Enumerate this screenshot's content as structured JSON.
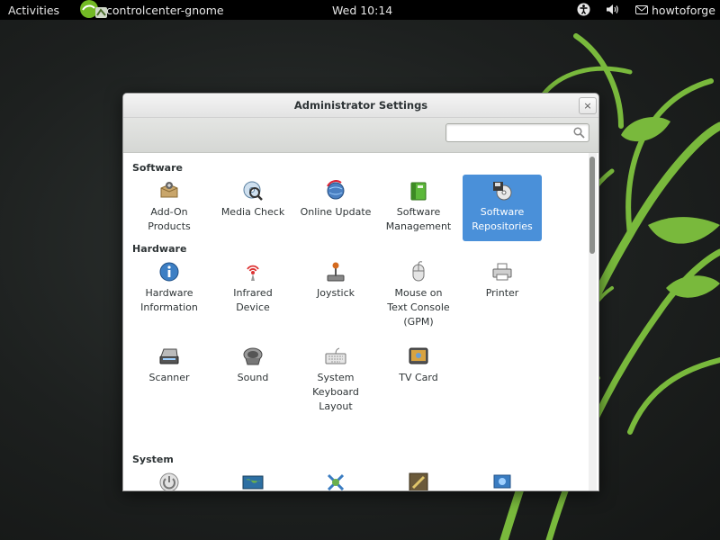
{
  "topbar": {
    "activities": "Activities",
    "app_name": "controlcenter-gnome",
    "clock": "Wed 10:14",
    "user": "howtoforge"
  },
  "window": {
    "title": "Administrator Settings",
    "close_glyph": "×"
  },
  "search": {
    "placeholder": ""
  },
  "sections": {
    "software": {
      "title": "Software",
      "items": [
        {
          "label": "Add-On\nProducts",
          "icon": "package-icon"
        },
        {
          "label": "Media Check",
          "icon": "disc-check-icon"
        },
        {
          "label": "Online Update",
          "icon": "update-globe-icon"
        },
        {
          "label": "Software\nManagement",
          "icon": "software-box-icon"
        },
        {
          "label": "Software\nRepositories",
          "icon": "repository-disc-icon",
          "selected": true
        }
      ]
    },
    "hardware": {
      "title": "Hardware",
      "items": [
        {
          "label": "Hardware\nInformation",
          "icon": "info-icon"
        },
        {
          "label": "Infrared\nDevice",
          "icon": "infrared-icon"
        },
        {
          "label": "Joystick",
          "icon": "joystick-icon"
        },
        {
          "label": "Mouse on\nText Console\n(GPM)",
          "icon": "mouse-icon"
        },
        {
          "label": "Printer",
          "icon": "printer-icon"
        },
        {
          "label": "Scanner",
          "icon": "scanner-icon"
        },
        {
          "label": "Sound",
          "icon": "speaker-icon"
        },
        {
          "label": "System\nKeyboard\nLayout",
          "icon": "keyboard-icon"
        },
        {
          "label": "TV Card",
          "icon": "tv-icon"
        }
      ]
    },
    "system": {
      "title": "System",
      "items": [
        {
          "icon": "power-icon"
        },
        {
          "icon": "map-icon"
        },
        {
          "icon": "tools-icon"
        },
        {
          "icon": "config-icon"
        },
        {
          "icon": "flag-icon"
        }
      ]
    }
  },
  "colors": {
    "selection": "#4a90d9",
    "wallpaper_green": "#7bc043",
    "topbar": "#000000"
  }
}
